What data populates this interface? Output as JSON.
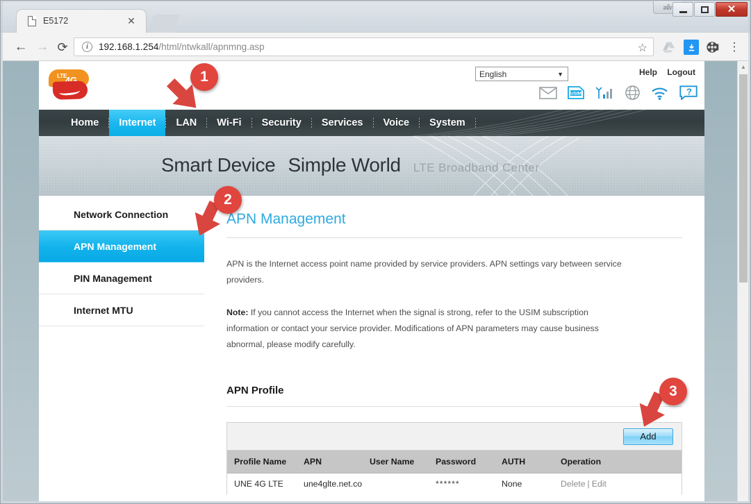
{
  "browser": {
    "tab": {
      "title": "E5172",
      "close_label": "✕",
      "favicon": "page-icon"
    },
    "window_controls": {
      "minimize": "–",
      "maximize": "□",
      "close": "✕",
      "mini_badge": "สติก"
    },
    "toolbar": {
      "back": "←",
      "forward": "→",
      "reload": "⟳",
      "url_host": "192.168.1.254",
      "url_path": "/html/ntwkall/apnmng.asp",
      "info_icon": "i",
      "star": "☆",
      "menu": "⋮",
      "download_glyph": "⬇"
    }
  },
  "router": {
    "logo": {
      "top_text": "4G",
      "top_sup": "LTE"
    },
    "header": {
      "language": "English",
      "caret": "▼",
      "help": "Help",
      "logout": "Logout",
      "icons": [
        "mail-icon",
        "usim-icon",
        "signal-icon",
        "globe-icon",
        "wifi-icon",
        "help-icon"
      ],
      "usim_label": "USIM",
      "help_label": "?"
    },
    "nav": [
      {
        "label": "Home",
        "active": false
      },
      {
        "label": "Internet",
        "active": true
      },
      {
        "label": "LAN",
        "active": false
      },
      {
        "label": "Wi-Fi",
        "active": false
      },
      {
        "label": "Security",
        "active": false
      },
      {
        "label": "Services",
        "active": false
      },
      {
        "label": "Voice",
        "active": false
      },
      {
        "label": "System",
        "active": false
      }
    ],
    "banner": {
      "line1": "Smart Device",
      "line2": "Simple World",
      "tagline": "LTE  Broadband  Center"
    },
    "sidebar": [
      {
        "label": "Network Connection",
        "active": false
      },
      {
        "label": "APN Management",
        "active": true
      },
      {
        "label": "PIN Management",
        "active": false
      },
      {
        "label": "Internet MTU",
        "active": false
      }
    ],
    "content": {
      "title": "APN Management",
      "paragraph1": "APN is the Internet access point name provided by service providers. APN settings vary between service providers.",
      "note_label": "Note:",
      "note_text": " If you cannot access the Internet when the signal is strong, refer to the USIM subscription information or contact your service provider. Modifications of APN parameters may cause business abnormal, please modify carefully.",
      "profile_title": "APN Profile",
      "add_label": "Add",
      "table": {
        "headers": [
          "Profile Name",
          "APN",
          "User Name",
          "Password",
          "AUTH",
          "Operation"
        ],
        "rows": [
          {
            "profile_name": "UNE 4G LTE",
            "apn": "une4glte.net.co",
            "user_name": "",
            "password": "******",
            "auth": "None",
            "delete": "Delete",
            "separator": "|",
            "edit": "Edit"
          }
        ]
      }
    }
  },
  "annotations": {
    "markers": [
      {
        "number": "1",
        "target": "Internet nav tab"
      },
      {
        "number": "2",
        "target": "APN Management sidebar item"
      },
      {
        "number": "3",
        "target": "Add button"
      }
    ],
    "color": "#e0453e"
  }
}
